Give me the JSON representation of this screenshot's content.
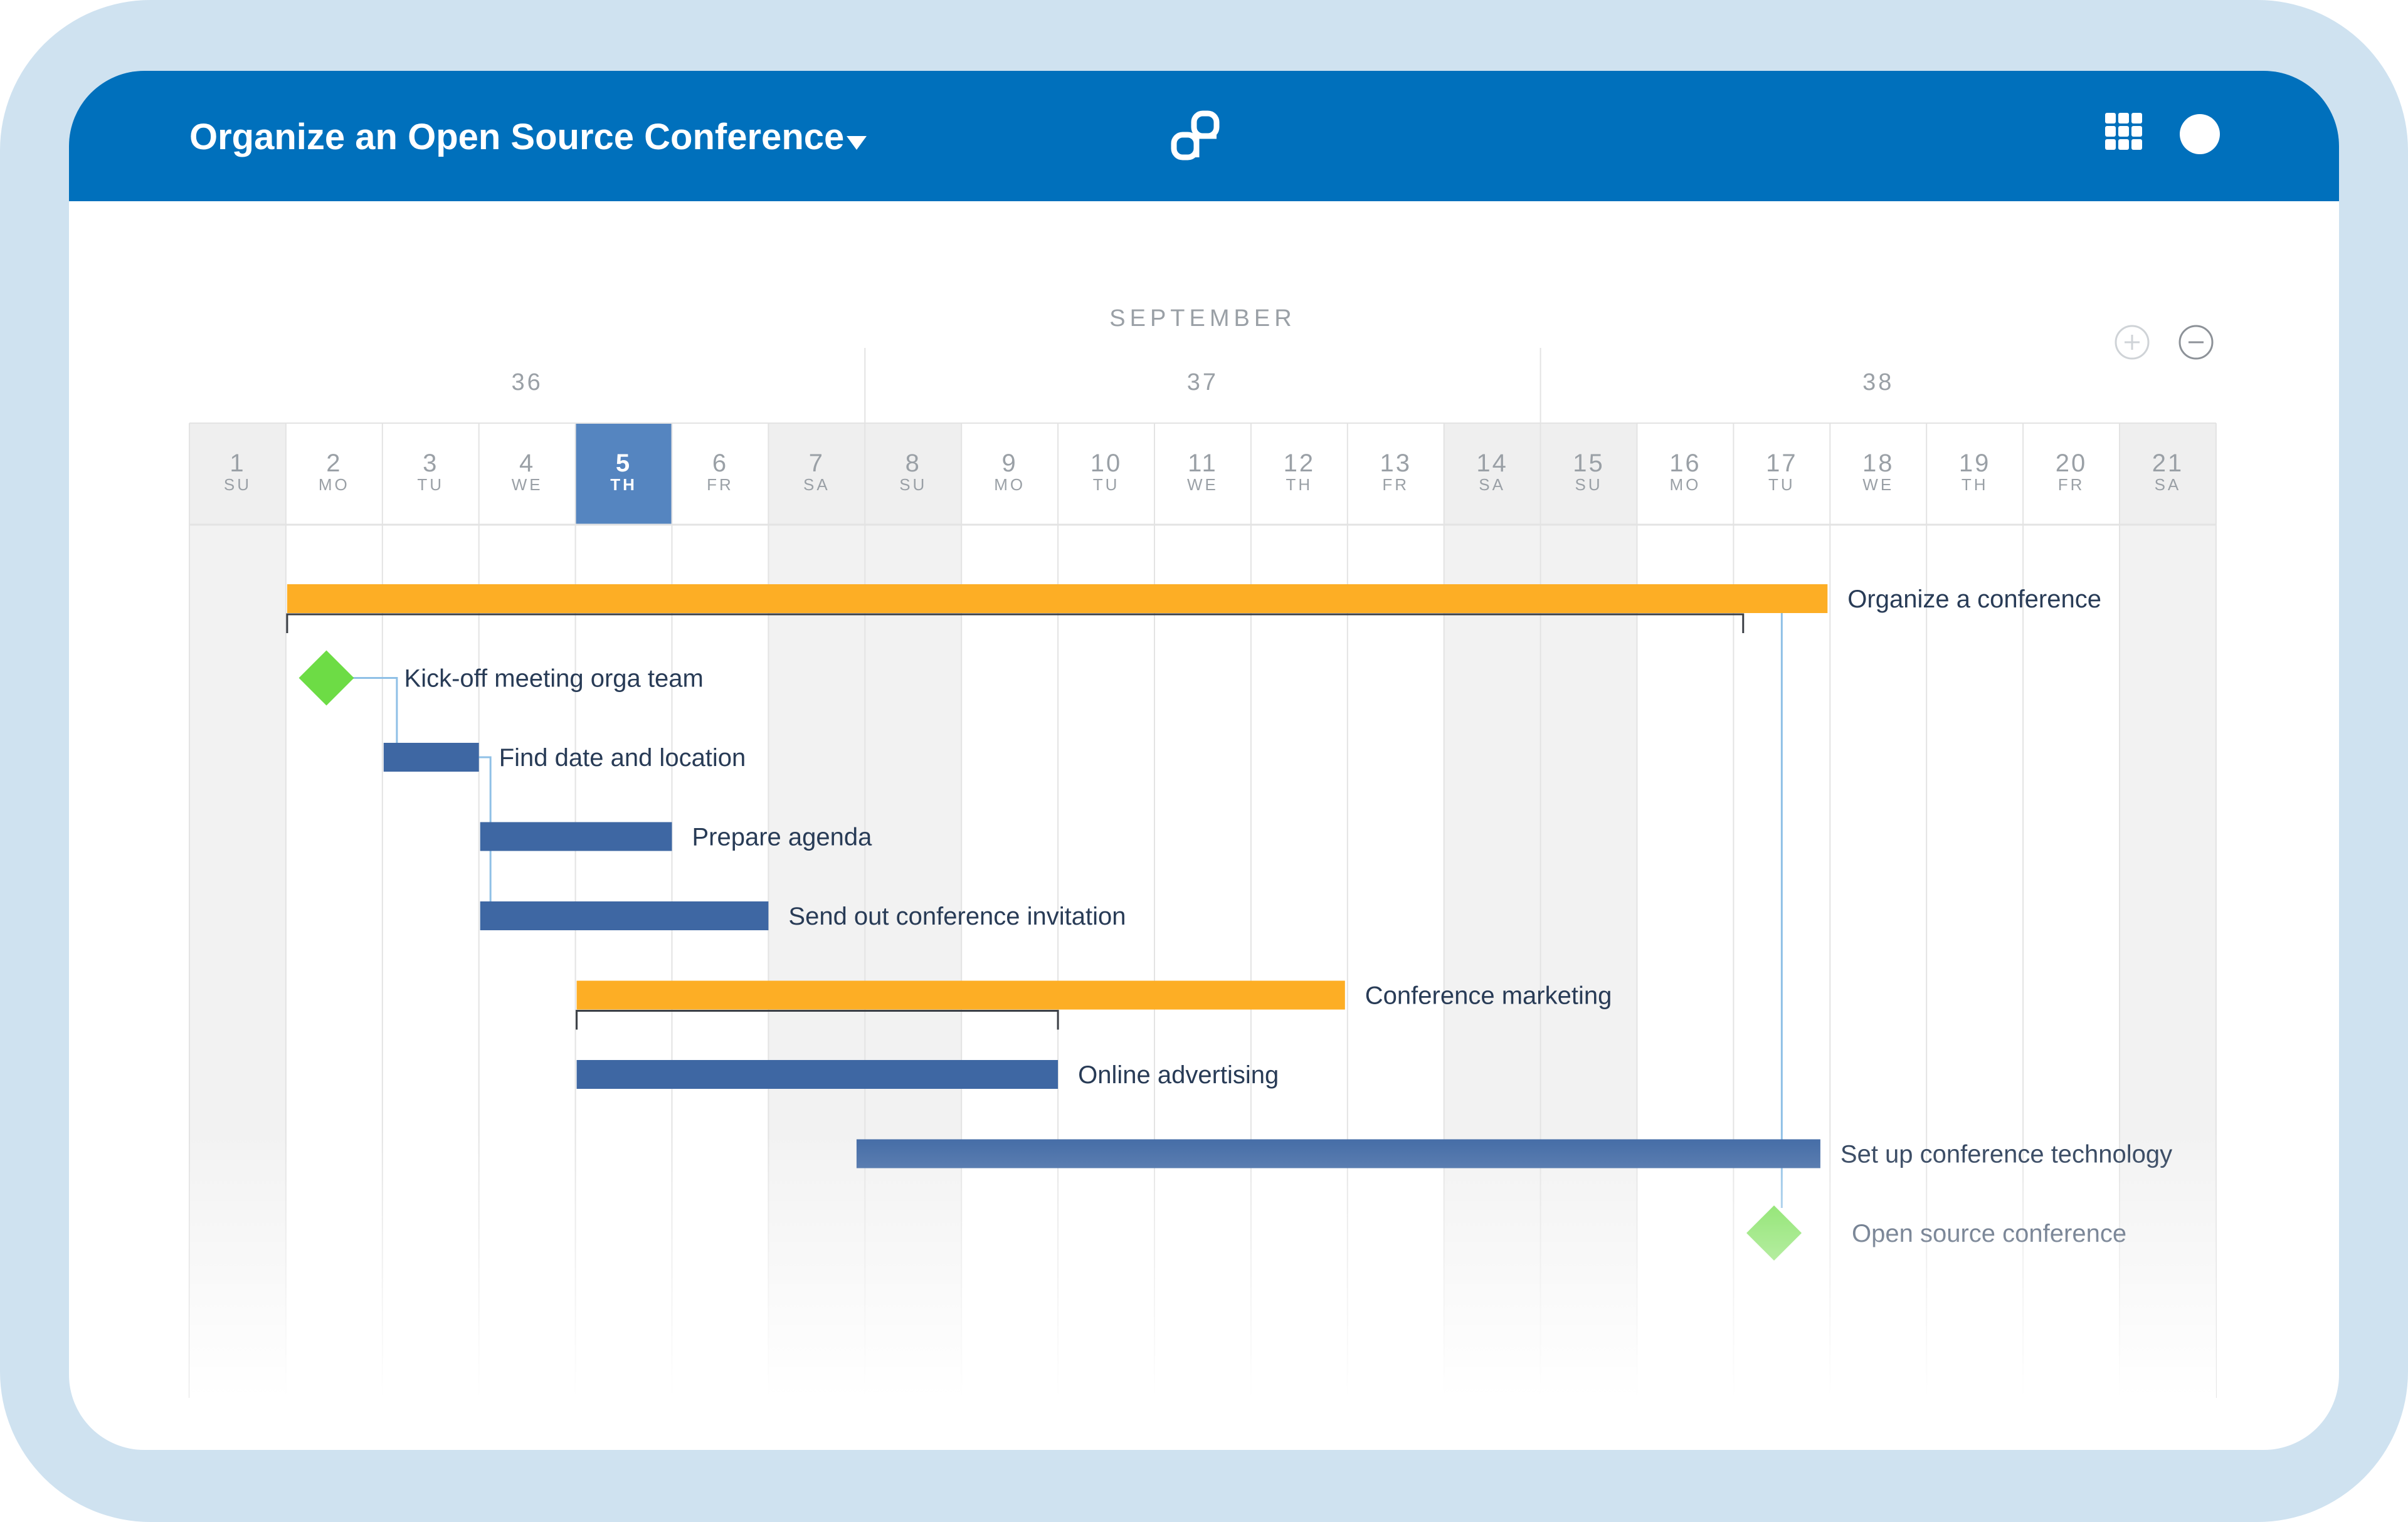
{
  "header": {
    "project_title": "Organize an Open Source Conference",
    "icons": [
      "caret-down-icon",
      "openproject-logo",
      "grid-icon",
      "avatar"
    ]
  },
  "timeline": {
    "month": "SEPTEMBER",
    "weeks": [
      "36",
      "37",
      "38"
    ],
    "today_index": 4,
    "days": [
      {
        "num": "1",
        "dow": "SU",
        "weekend": true
      },
      {
        "num": "2",
        "dow": "MO",
        "weekend": false
      },
      {
        "num": "3",
        "dow": "TU",
        "weekend": false
      },
      {
        "num": "4",
        "dow": "WE",
        "weekend": false
      },
      {
        "num": "5",
        "dow": "TH",
        "weekend": false
      },
      {
        "num": "6",
        "dow": "FR",
        "weekend": false
      },
      {
        "num": "7",
        "dow": "SA",
        "weekend": true
      },
      {
        "num": "8",
        "dow": "SU",
        "weekend": true
      },
      {
        "num": "9",
        "dow": "MO",
        "weekend": false
      },
      {
        "num": "10",
        "dow": "TU",
        "weekend": false
      },
      {
        "num": "11",
        "dow": "WE",
        "weekend": false
      },
      {
        "num": "12",
        "dow": "TH",
        "weekend": false
      },
      {
        "num": "13",
        "dow": "FR",
        "weekend": false
      },
      {
        "num": "14",
        "dow": "SA",
        "weekend": true
      },
      {
        "num": "15",
        "dow": "SU",
        "weekend": true
      },
      {
        "num": "16",
        "dow": "MO",
        "weekend": false
      },
      {
        "num": "17",
        "dow": "TU",
        "weekend": false
      },
      {
        "num": "18",
        "dow": "WE",
        "weekend": false
      },
      {
        "num": "19",
        "dow": "TH",
        "weekend": false
      },
      {
        "num": "20",
        "dow": "FR",
        "weekend": false
      },
      {
        "num": "21",
        "dow": "SA",
        "weekend": true
      }
    ]
  },
  "colors": {
    "phase": "#fdae25",
    "task": "#3e67a3",
    "milestone": "#6ddc45",
    "header_bar": "#0070bc",
    "today": "#5585c0",
    "relation": "#8fc0e6"
  },
  "work_packages": [
    {
      "name": "Organize a conference",
      "type": "phase",
      "start": 1,
      "end": 16
    },
    {
      "name": "Kick-off meeting orga team",
      "type": "milestone",
      "start": 1,
      "end": 1
    },
    {
      "name": "Find date and location",
      "type": "task",
      "start": 2,
      "end": 2
    },
    {
      "name": "Prepare agenda",
      "type": "task",
      "start": 3,
      "end": 4
    },
    {
      "name": "Send out conference invitation",
      "type": "task",
      "start": 3,
      "end": 5
    },
    {
      "name": "Conference marketing",
      "type": "phase",
      "start": 4,
      "end": 11
    },
    {
      "name": "Online advertising",
      "type": "task",
      "start": 4,
      "end": 8
    },
    {
      "name": "Set up conference technology",
      "type": "task",
      "start": 6.9,
      "end": 15.9
    },
    {
      "name": "Open source conference",
      "type": "milestone",
      "start": 16,
      "end": 16
    }
  ],
  "controls": {
    "zoom_in": "zoom-in-icon",
    "zoom_out": "zoom-out-icon"
  }
}
